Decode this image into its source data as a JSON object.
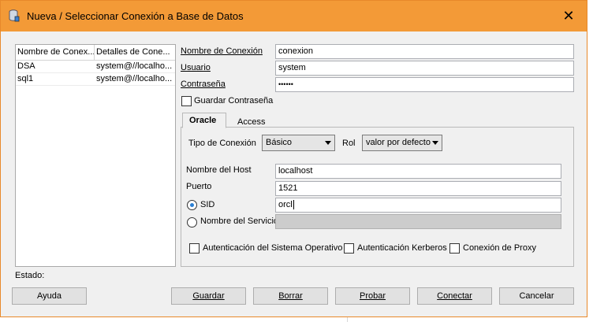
{
  "window": {
    "title": "Nueva / Seleccionar Conexión a Base de Datos",
    "close_glyph": "✕",
    "accent": "#f39a37"
  },
  "list": {
    "headers": [
      "Nombre de Conex...",
      "Detalles de Cone..."
    ],
    "rows": [
      {
        "name": "DSA",
        "details": "system@//localho..."
      },
      {
        "name": "sql1",
        "details": "system@//localho..."
      }
    ]
  },
  "form": {
    "name_label": "Nombre de Conexión",
    "name_value": "conexion",
    "user_label": "Usuario",
    "user_value": "system",
    "password_label": "Contraseña",
    "password_value": "••••••",
    "save_password_label": "Guardar Contraseña"
  },
  "tabs": {
    "oracle": "Oracle",
    "access": "Access"
  },
  "oracle": {
    "conn_type_label": "Tipo de Conexión",
    "conn_type_value": "Básico",
    "role_label": "Rol",
    "role_value": "valor por defecto",
    "host_label": "Nombre del Host",
    "host_value": "localhost",
    "port_label": "Puerto",
    "port_value": "1521",
    "sid_label": "SID",
    "sid_value": "orcl",
    "service_label": "Nombre del Servicio",
    "os_auth_label": "Autenticación del Sistema Operativo",
    "kerberos_label": "Autenticación Kerberos",
    "proxy_label": "Conexión de Proxy"
  },
  "status": {
    "label": "Estado:"
  },
  "buttons": {
    "help": "Ayuda",
    "save": "Guardar",
    "delete": "Borrar",
    "test": "Probar",
    "connect": "Conectar",
    "cancel": "Cancelar"
  }
}
